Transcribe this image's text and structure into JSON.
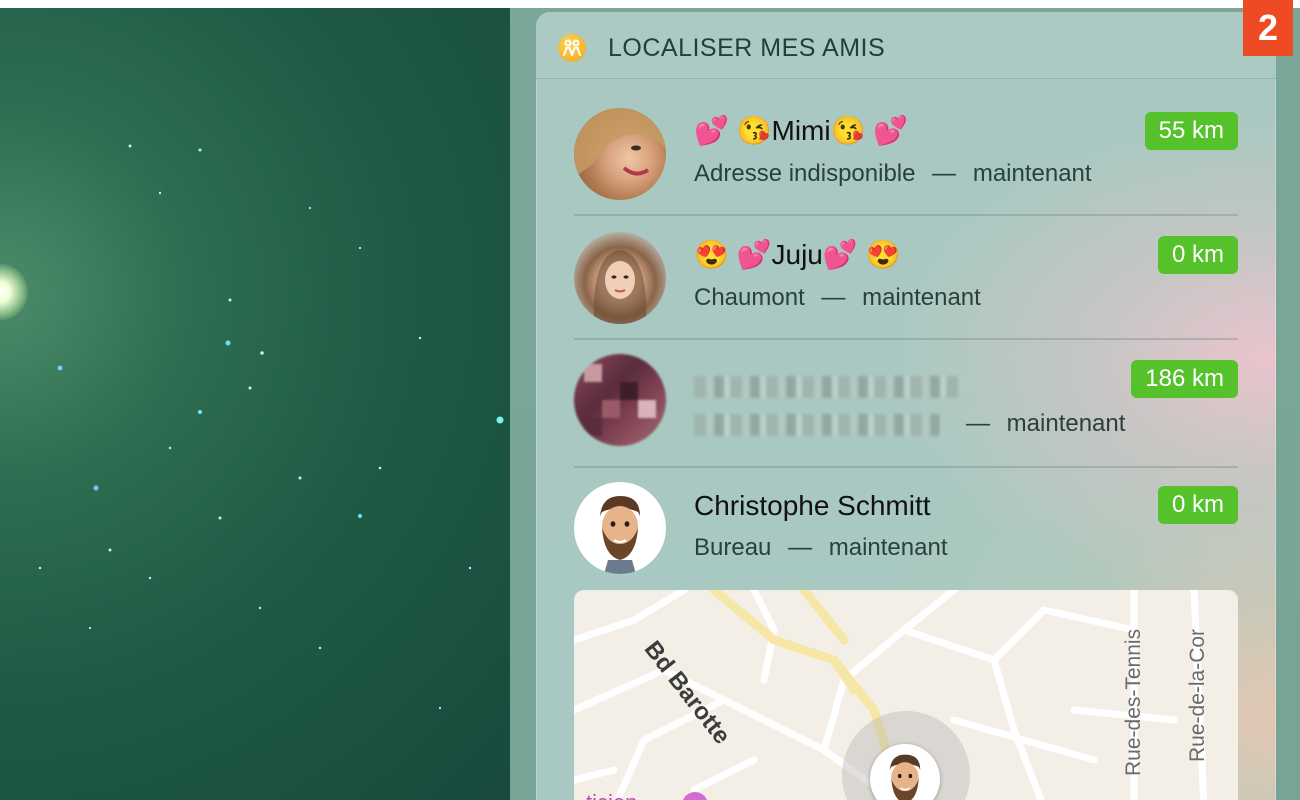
{
  "badge": "2",
  "widget": {
    "title": "LOCALISER MES AMIS",
    "icon": "find-friends-icon"
  },
  "friends": [
    {
      "name": "💕 😘Mimi😘 💕",
      "location": "Adresse indisponible",
      "separator": "—",
      "time": "maintenant",
      "distance": "55 km"
    },
    {
      "name": "😍 💕Juju💕 😍",
      "location": "Chaumont",
      "separator": "—",
      "time": "maintenant",
      "distance": "0 km"
    },
    {
      "name": "",
      "location": "",
      "separator": "—",
      "time": "maintenant",
      "distance": "186 km"
    },
    {
      "name": "Christophe Schmitt",
      "location": "Bureau",
      "separator": "—",
      "time": "maintenant",
      "distance": "0 km"
    }
  ],
  "map": {
    "streets": [
      "Bd Barotte",
      "Rue-des-Tennis",
      "Rue-de-la-Cor"
    ],
    "poi_partial": "ticien"
  },
  "colors": {
    "distance_badge": "#55c22c",
    "step_badge": "#ee4a24",
    "widget_bg": "#a9c8c1"
  }
}
